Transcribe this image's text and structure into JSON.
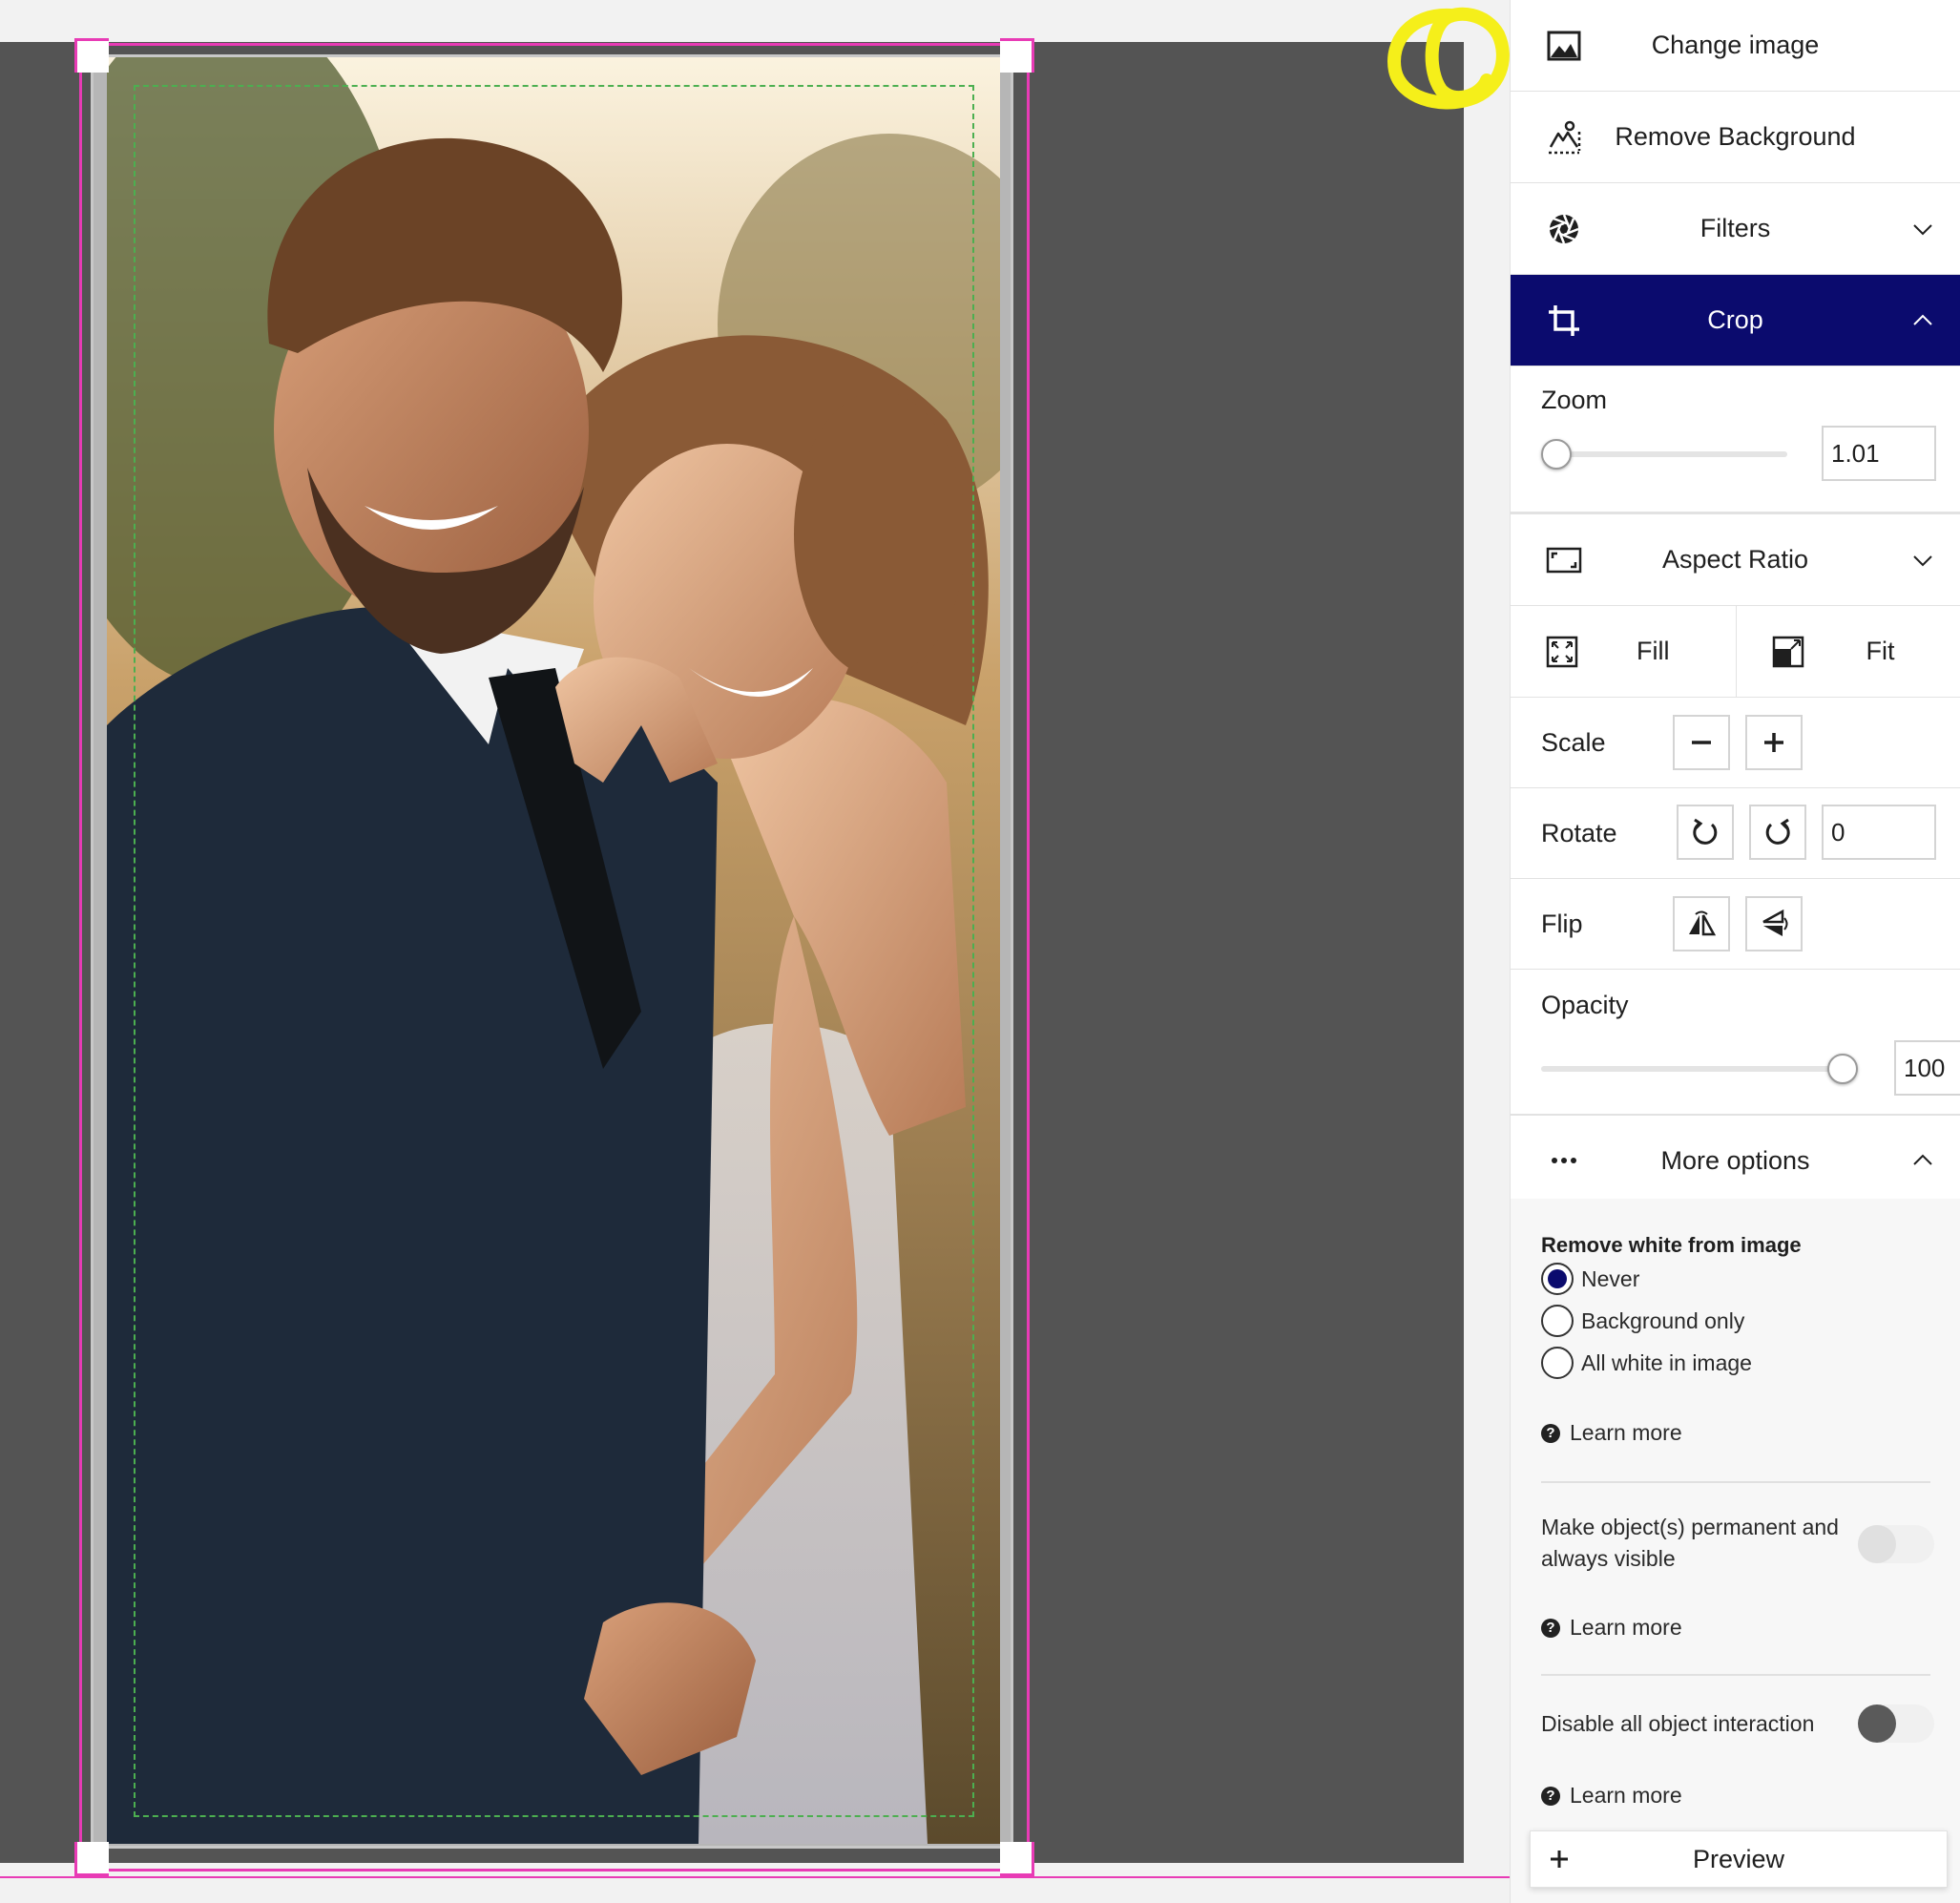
{
  "panel": {
    "change_image": "Change image",
    "remove_background": "Remove Background",
    "filters": "Filters",
    "crop": "Crop",
    "zoom_label": "Zoom",
    "zoom_value": "1.01",
    "zoom_level": 0.0,
    "aspect_ratio": "Aspect Ratio",
    "fill": "Fill",
    "fit": "Fit",
    "scale_label": "Scale",
    "rotate_label": "Rotate",
    "rotate_value": "0",
    "flip_label": "Flip",
    "opacity_label": "Opacity",
    "opacity_value": "100",
    "opacity_level": 1.0,
    "more_options": "More options",
    "remove_white_title": "Remove white from image",
    "radio_options": [
      "Never",
      "Background only",
      "All white in image"
    ],
    "radio_selected": "Never",
    "learn_more": "Learn more",
    "permanent_line1": "Make object(s) permanent and",
    "permanent_line2": "always visible",
    "permanent_enabled": false,
    "disable_interaction": "Disable all object interaction",
    "disable_interaction_enabled": false,
    "preview": "Preview"
  },
  "colors": {
    "accent": "#0b0b6e",
    "selection": "#e83bb5",
    "safe_area": "#4caf50",
    "canvas": "#545454",
    "highlight": "#f5ef1a"
  },
  "icons": [
    "image-icon",
    "remove-background-icon",
    "filters-aperture-icon",
    "crop-icon",
    "aspect-ratio-icon",
    "fill-icon",
    "fit-icon",
    "minus-icon",
    "plus-icon",
    "rotate-left-icon",
    "rotate-right-icon",
    "flip-horizontal-icon",
    "flip-vertical-icon",
    "more-dots-icon",
    "chevron-down-icon",
    "chevron-up-icon",
    "help-icon"
  ]
}
